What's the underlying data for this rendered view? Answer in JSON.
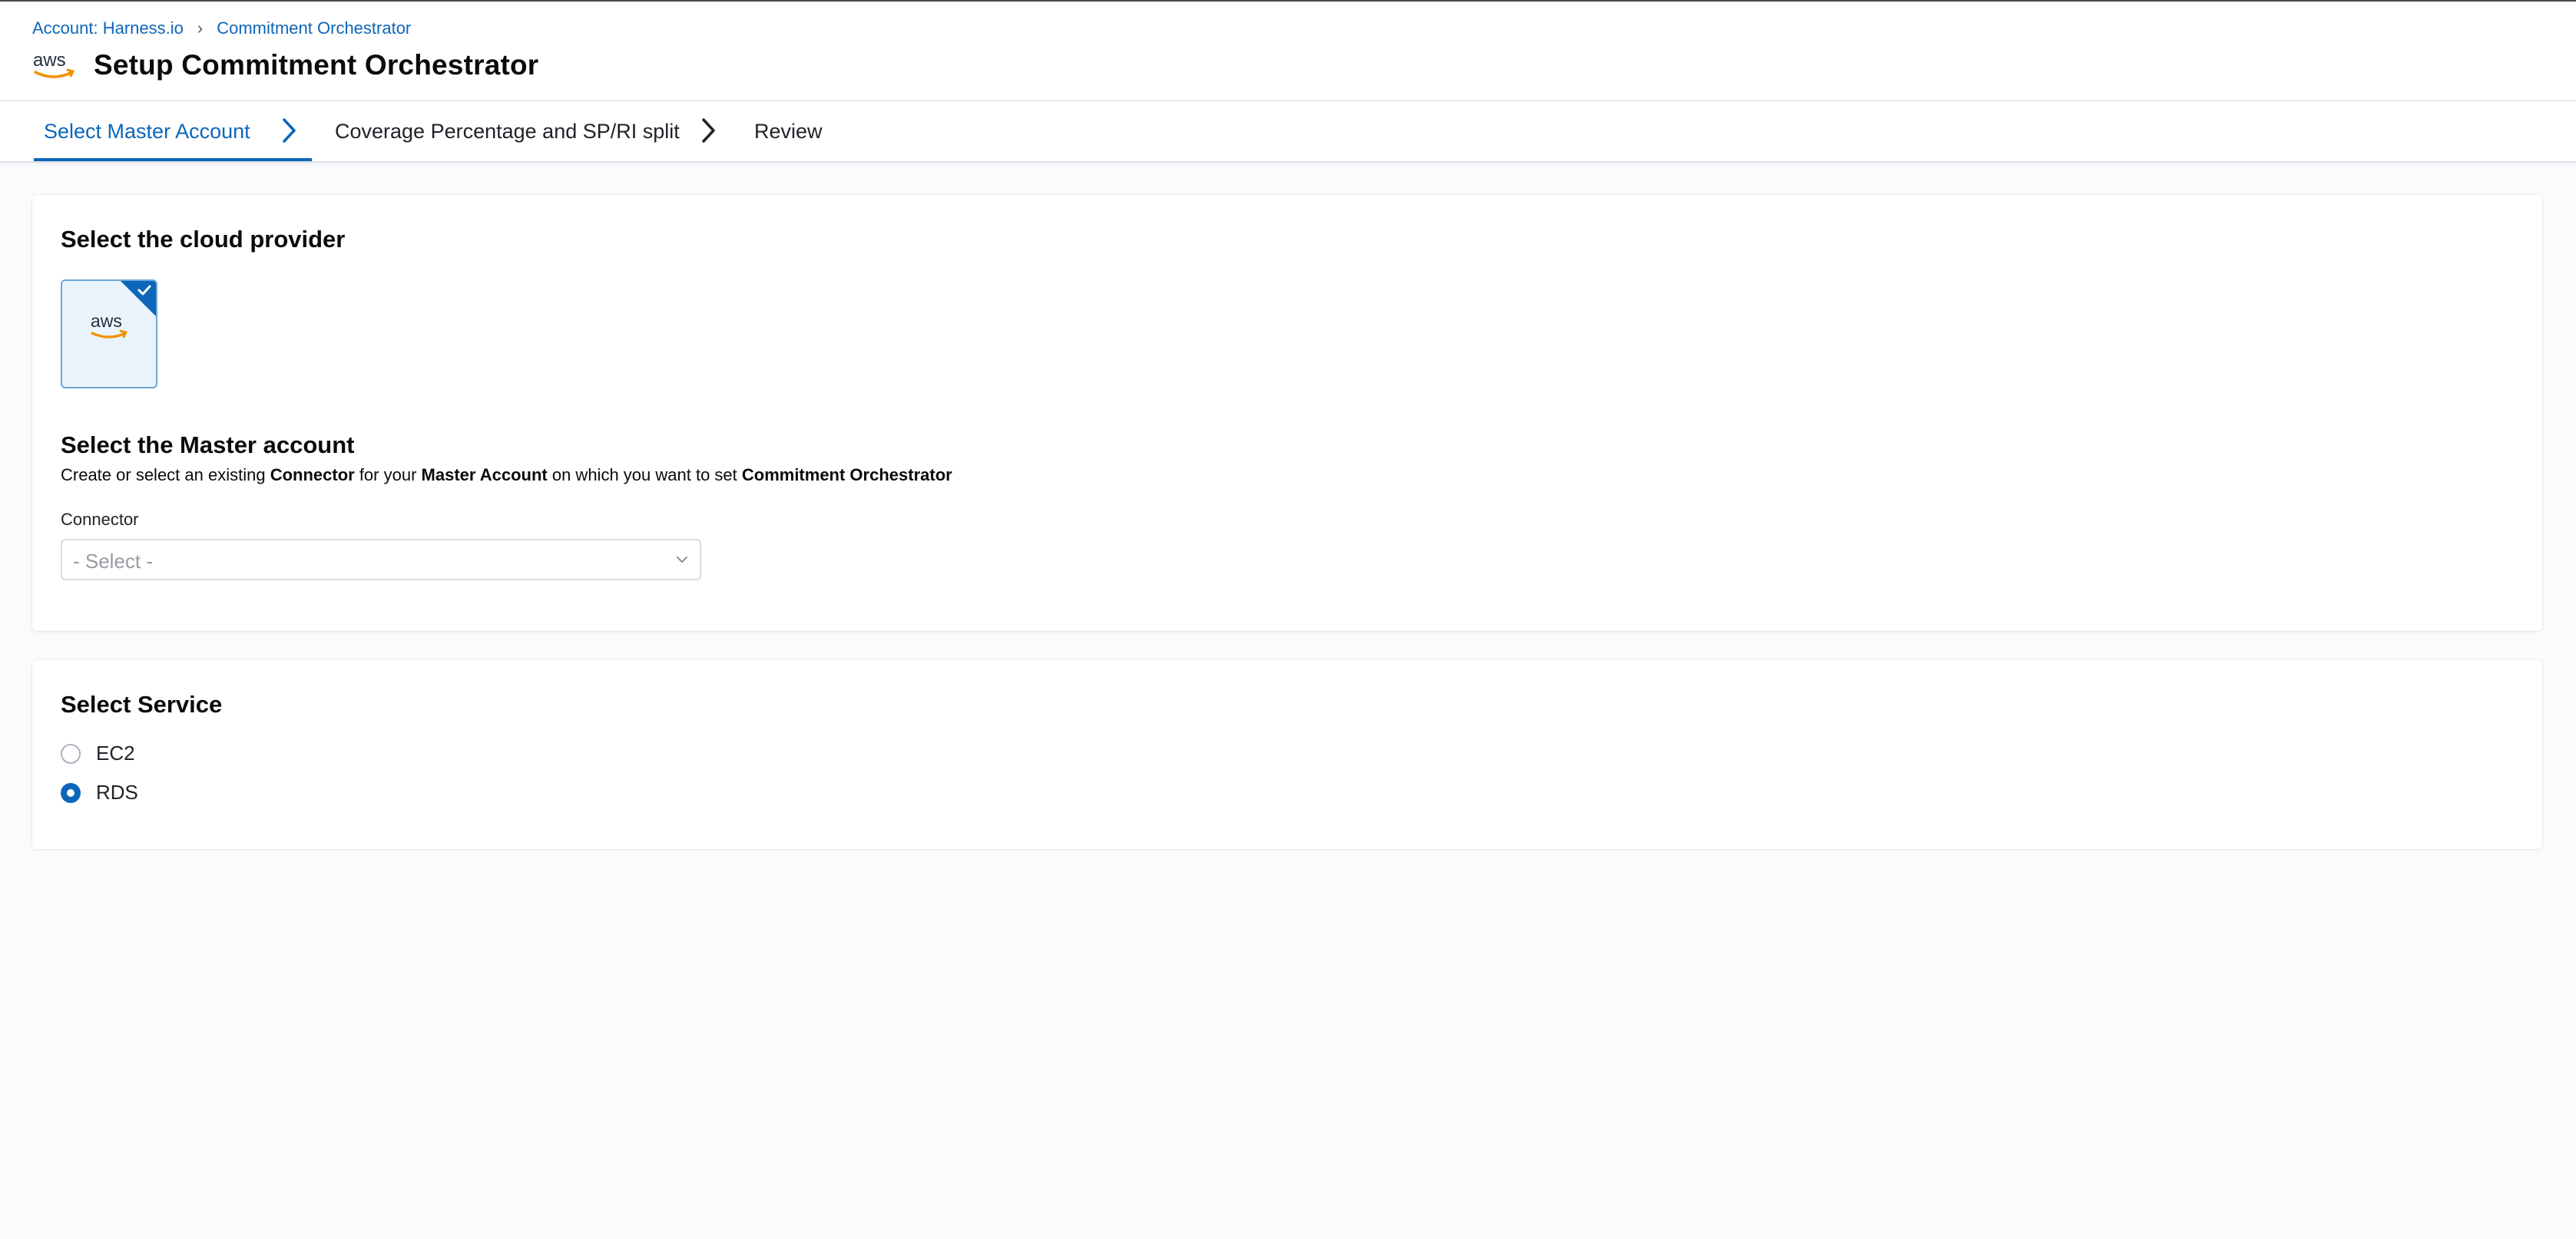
{
  "breadcrumb": {
    "account": "Account: Harness.io",
    "separator": "›",
    "current": "Commitment Orchestrator"
  },
  "header": {
    "title": "Setup Commitment Orchestrator",
    "logo_text": "aws"
  },
  "steps": [
    {
      "label": "Select Master Account",
      "active": true
    },
    {
      "label": "Coverage Percentage and SP/RI split",
      "active": false
    },
    {
      "label": "Review",
      "active": false
    }
  ],
  "provider_section": {
    "title": "Select the cloud provider",
    "tile_text": "aws",
    "selected": true
  },
  "master_section": {
    "title": "Select the Master account",
    "desc_1": "Create or select an existing ",
    "desc_b1": "Connector",
    "desc_2": " for your ",
    "desc_b2": "Master Account",
    "desc_3": " on which you want to set ",
    "desc_b3": "Commitment Orchestrator",
    "connector_label": "Connector",
    "connector_value": "- Select -"
  },
  "service_section": {
    "title": "Select Service",
    "options": [
      {
        "label": "EC2",
        "selected": false
      },
      {
        "label": "RDS",
        "selected": true
      }
    ]
  },
  "colors": {
    "accent": "#0d66b9",
    "background": "#fafbfd",
    "tile_bg": "#eaf4fc",
    "aws_orange": "#f29100"
  }
}
